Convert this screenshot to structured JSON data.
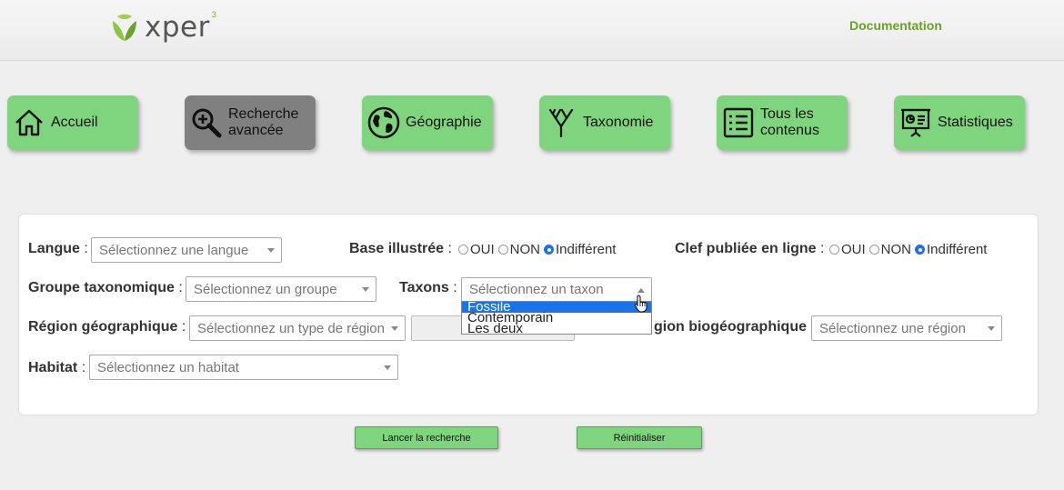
{
  "header": {
    "logo_text": "xper",
    "logo_sup": "3",
    "doc_link": "Documentation"
  },
  "nav": [
    {
      "label": "Accueil",
      "icon": "home-icon",
      "active": false
    },
    {
      "label": "Recherche avancée",
      "icon": "zoom-in-icon",
      "active": true
    },
    {
      "label": "Géographie",
      "icon": "globe-icon",
      "active": false
    },
    {
      "label": "Taxonomie",
      "icon": "taxonomy-tree-icon",
      "active": false
    },
    {
      "label": "Tous les contenus",
      "icon": "list-icon",
      "active": false
    },
    {
      "label": "Statistiques",
      "icon": "presentation-icon",
      "active": false
    }
  ],
  "form": {
    "langue": {
      "label": "Langue",
      "placeholder": "Sélectionnez une langue"
    },
    "base_illustree": {
      "label": "Base illustrée",
      "options": [
        "OUI",
        "NON",
        "Indifférent"
      ],
      "selected": "Indifférent"
    },
    "clef_publiee": {
      "label": "Clef publiée en ligne",
      "options": [
        "OUI",
        "NON",
        "Indifférent"
      ],
      "selected": "Indifférent"
    },
    "groupe": {
      "label": "Groupe taxonomique",
      "placeholder": "Sélectionnez un groupe"
    },
    "taxons": {
      "label": "Taxons",
      "placeholder": "Sélectionnez un taxon",
      "dropdown_options": [
        "Fossile",
        "Contemporain",
        "Les deux"
      ],
      "highlighted": "Fossile"
    },
    "region_geo": {
      "label": "Région géographique",
      "placeholder": "Sélectionnez un type de région"
    },
    "region_bio": {
      "label": "gion biogéographique",
      "placeholder": "Sélectionnez une région"
    },
    "habitat": {
      "label": "Habitat",
      "placeholder": "Sélectionnez un habitat"
    },
    "colon": ":"
  },
  "actions": {
    "search": "Lancer la recherche",
    "reset": "Réinitialiser"
  },
  "colors": {
    "nav_green": "#7fd47e",
    "nav_active": "#808080",
    "link_green": "#6c9f2c",
    "select_blue": "#1a73e8"
  }
}
